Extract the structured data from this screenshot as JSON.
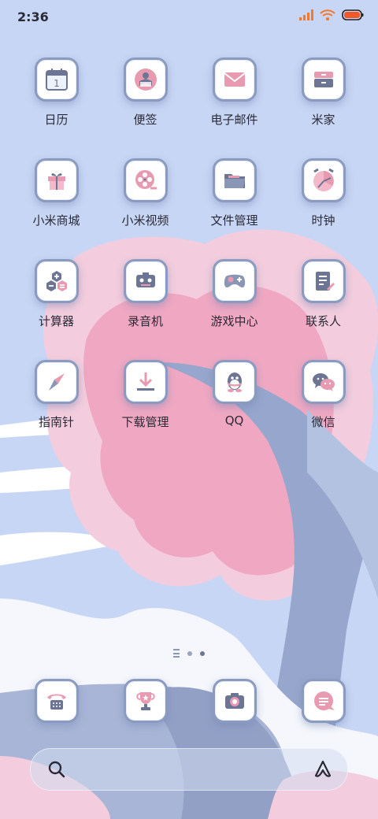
{
  "status": {
    "time": "2:36",
    "battery_color": "#f05a28",
    "signal_color": "#f07a30"
  },
  "apps": [
    {
      "label": "日历",
      "icon": "calendar-icon",
      "day": "1"
    },
    {
      "label": "便签",
      "icon": "notes-icon"
    },
    {
      "label": "电子邮件",
      "icon": "email-icon"
    },
    {
      "label": "米家",
      "icon": "mijia-icon"
    },
    {
      "label": "小米商城",
      "icon": "gift-icon"
    },
    {
      "label": "小米视频",
      "icon": "film-reel-icon"
    },
    {
      "label": "文件管理",
      "icon": "folder-icon"
    },
    {
      "label": "时钟",
      "icon": "clock-icon"
    },
    {
      "label": "计算器",
      "icon": "calculator-icon"
    },
    {
      "label": "录音机",
      "icon": "recorder-icon"
    },
    {
      "label": "游戏中心",
      "icon": "gamepad-icon"
    },
    {
      "label": "联系人",
      "icon": "contacts-icon"
    },
    {
      "label": "指南针",
      "icon": "compass-icon"
    },
    {
      "label": "下载管理",
      "icon": "download-icon"
    },
    {
      "label": "QQ",
      "icon": "qq-penguin-icon"
    },
    {
      "label": "微信",
      "icon": "wechat-icon"
    }
  ],
  "dock": [
    {
      "icon": "phone-icon"
    },
    {
      "icon": "trophy-icon"
    },
    {
      "icon": "camera-icon"
    },
    {
      "icon": "message-icon"
    }
  ],
  "colors": {
    "pink": "#e89ab0",
    "navy": "#6c7694",
    "bg": "#c8d6f5"
  }
}
